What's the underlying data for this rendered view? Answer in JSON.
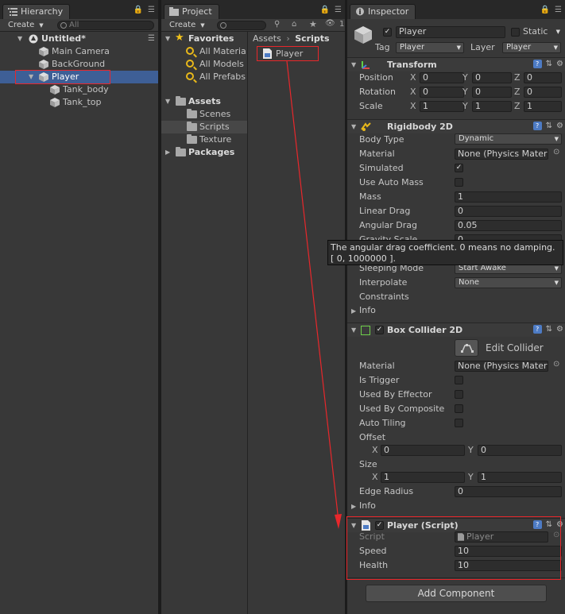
{
  "hierarchy": {
    "tab": "Hierarchy",
    "create": "Create",
    "search_placeholder": "All",
    "scene": "Untitled*",
    "items": [
      "Main Camera",
      "BackGround",
      "Player",
      "Tank_body",
      "Tank_top"
    ]
  },
  "project": {
    "tab": "Project",
    "create": "Create",
    "favorites": "Favorites",
    "fav_items": [
      "All Materia",
      "All Models",
      "All Prefabs"
    ],
    "assets": "Assets",
    "asset_folders": [
      "Scenes",
      "Scripts",
      "Texture"
    ],
    "packages": "Packages",
    "breadcrumb": [
      "Assets",
      "Scripts"
    ],
    "file": "Player",
    "count": "1"
  },
  "inspector": {
    "tab": "Inspector",
    "name": "Player",
    "static": "Static",
    "tag_label": "Tag",
    "tag_value": "Player",
    "layer_label": "Layer",
    "layer_value": "Player",
    "transform": {
      "title": "Transform",
      "rows": [
        {
          "label": "Position",
          "x": "0",
          "y": "0",
          "z": "0"
        },
        {
          "label": "Rotation",
          "x": "0",
          "y": "0",
          "z": "0"
        },
        {
          "label": "Scale",
          "x": "1",
          "y": "1",
          "z": "1"
        }
      ],
      "axes": [
        "X",
        "Y",
        "Z"
      ]
    },
    "rigidbody": {
      "title": "Rigidbody 2D",
      "body_type_label": "Body Type",
      "body_type": "Dynamic",
      "material_label": "Material",
      "material": "None (Physics Mater",
      "simulated_label": "Simulated",
      "auto_mass_label": "Use Auto Mass",
      "mass_label": "Mass",
      "mass": "1",
      "linear_drag_label": "Linear Drag",
      "linear_drag": "0",
      "angular_drag_label": "Angular Drag",
      "angular_drag": "0.05",
      "gravity_label": "Gravity Scale",
      "gravity": "0",
      "sleeping_label": "Sleeping Mode",
      "sleeping": "Start Awake",
      "interpolate_label": "Interpolate",
      "interpolate": "None",
      "constraints_label": "Constraints",
      "info_label": "Info"
    },
    "tooltip": {
      "line1": "The angular drag coefficient. 0 means no damping.",
      "line2": "[ 0, 1000000  ]."
    },
    "boxcollider": {
      "title": "Box Collider 2D",
      "edit_collider": "Edit Collider",
      "material_label": "Material",
      "material": "None (Physics Mater",
      "trigger_label": "Is Trigger",
      "effector_label": "Used By Effector",
      "composite_label": "Used By Composite",
      "autotiling_label": "Auto Tiling",
      "offset_label": "Offset",
      "offset_x": "0",
      "offset_y": "0",
      "size_label": "Size",
      "size_x": "1",
      "size_y": "1",
      "edge_label": "Edge Radius",
      "edge": "0",
      "info_label": "Info",
      "x": "X",
      "y": "Y"
    },
    "script": {
      "title": "Player (Script)",
      "script_label": "Script",
      "script_value": "Player",
      "speed_label": "Speed",
      "speed": "10",
      "health_label": "Health",
      "health": "10"
    },
    "add_component": "Add Component"
  },
  "colors": {
    "selection": "#3e5f96",
    "highlight": "#e8272b",
    "panel": "#383838"
  }
}
